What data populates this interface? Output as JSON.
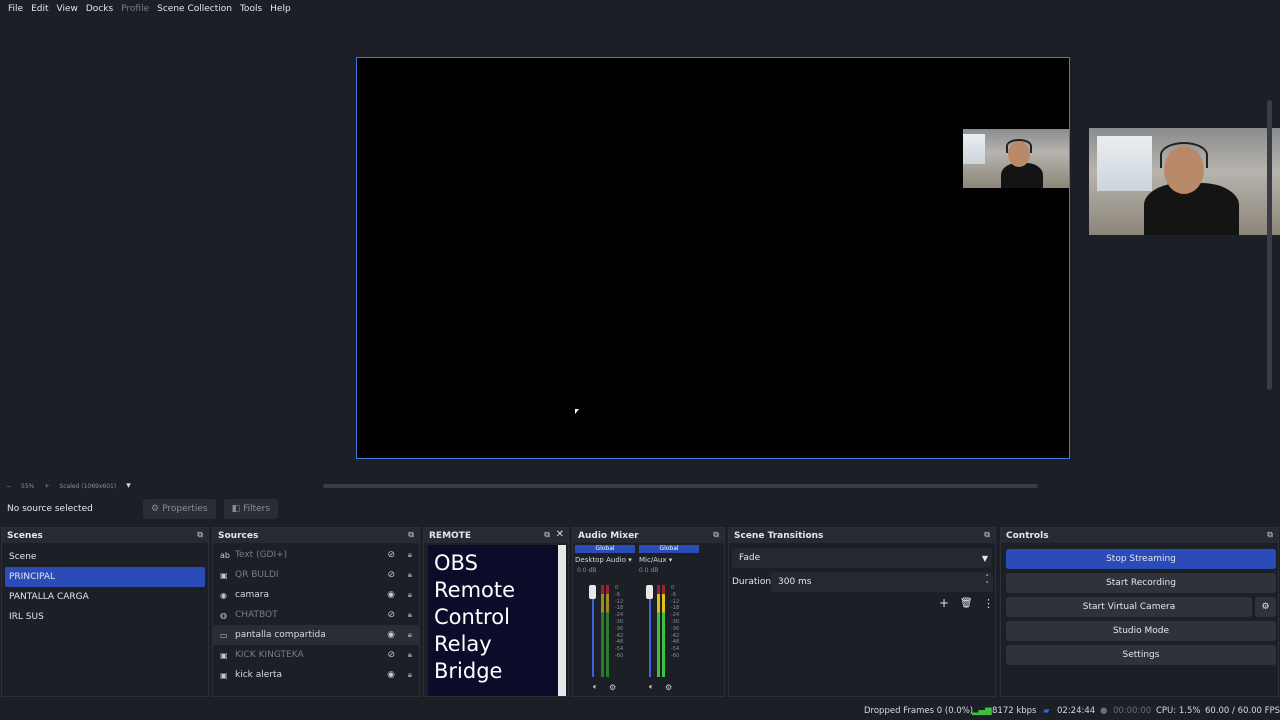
{
  "menu": [
    "File",
    "Edit",
    "View",
    "Docks",
    "Profile",
    "Scene Collection",
    "Tools",
    "Help"
  ],
  "zoombar": {
    "minus": "−",
    "zoom": "55%",
    "plus": "+",
    "scaled": "Scaled (1069x601)",
    "dropdown": "▾"
  },
  "source_bar": {
    "no_selection": "No source selected",
    "properties": "Properties",
    "filters": "Filters"
  },
  "scenes": {
    "title": "Scenes",
    "items": [
      {
        "label": "Scene",
        "selected": false
      },
      {
        "label": "PRINCIPAL",
        "selected": true
      },
      {
        "label": "PANTALLA CARGA",
        "selected": false
      },
      {
        "label": "IRL SUS",
        "selected": false
      }
    ]
  },
  "sources": {
    "title": "Sources",
    "items": [
      {
        "label": "Text (GDI+)",
        "icon": "ab",
        "visible": false
      },
      {
        "label": "QR BULDI",
        "icon": "▣",
        "visible": false
      },
      {
        "label": "camara",
        "icon": "◉",
        "visible": true
      },
      {
        "label": "CHATBOT",
        "icon": "◍",
        "visible": false
      },
      {
        "label": "pantalla compartida",
        "icon": "▭",
        "visible": true
      },
      {
        "label": "KICK KINGTEKA",
        "icon": "▣",
        "visible": false
      },
      {
        "label": "kick alerta",
        "icon": "▣",
        "visible": true
      }
    ]
  },
  "remote": {
    "title": "REMOTE",
    "lines": [
      "OBS",
      "Remote",
      "Control",
      "Relay",
      "Bridge"
    ]
  },
  "mixer": {
    "title": "Audio Mixer",
    "channels": [
      {
        "badge": "Global",
        "name": "Desktop Audio",
        "db": "0.0 dB"
      },
      {
        "badge": "Global",
        "name": "Mic/Aux",
        "db": "0.0 dB"
      }
    ],
    "scale": [
      "0",
      "-6",
      "-12",
      "-18",
      "-24",
      "-30",
      "-36",
      "-42",
      "-48",
      "-54",
      "-60"
    ]
  },
  "transitions": {
    "title": "Scene Transitions",
    "type": "Fade",
    "duration_label": "Duration",
    "duration_value": "300 ms"
  },
  "controls": {
    "title": "Controls",
    "buttons": [
      "Stop Streaming",
      "Start Recording",
      "Start Virtual Camera",
      "Studio Mode",
      "Settings"
    ]
  },
  "status": {
    "dropped": "Dropped Frames 0 (0.0%)",
    "bitrate": "8172 kbps",
    "stream_time": "02:24:44",
    "rec_time": "00:00:00",
    "cpu": "CPU: 1.5%",
    "fps": "60.00 / 60.00 FPS"
  },
  "colors": {
    "accent": "#2a4bb8",
    "preview_border": "#3d7be0",
    "bg": "#1d1f26"
  }
}
